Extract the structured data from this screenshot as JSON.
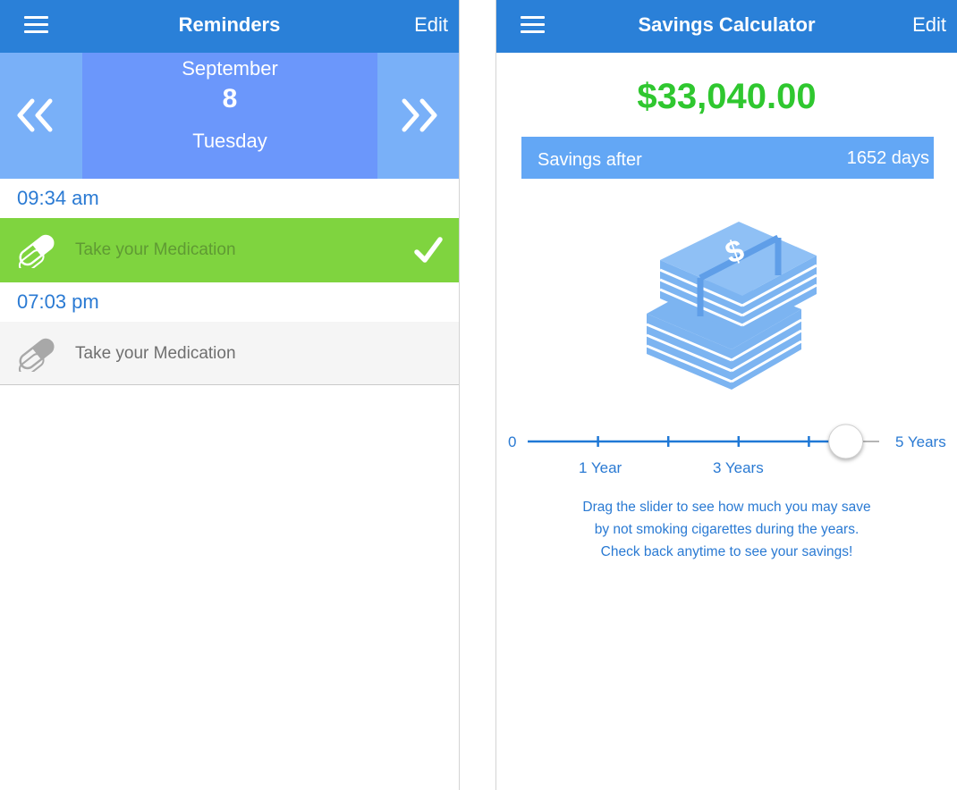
{
  "reminders_screen": {
    "title": "Reminders",
    "edit_label": "Edit",
    "date": {
      "month": "September",
      "day": "8",
      "weekday": "Tuesday"
    },
    "reminders": [
      {
        "time": "09:34 am",
        "text": "Take your Medication",
        "status": "taken",
        "icon": "pill-icon"
      },
      {
        "time": "07:03 pm",
        "text": "Take your Medication",
        "status": "pending",
        "icon": "pill-icon"
      }
    ]
  },
  "savings_screen": {
    "title": "Savings Calculator",
    "edit_label": "Edit",
    "amount": "$33,040.00",
    "savings_label": "Savings after",
    "days": "1652 days",
    "icon": "money-stack-icon",
    "slider": {
      "min_label": "0",
      "max_label": "5 Years",
      "tick_labels": [
        "1 Year",
        "3 Years"
      ],
      "value_fraction": 0.905
    },
    "help_lines": [
      "Drag the slider to see how much you may save",
      "by not smoking cigarettes during the years.",
      "Check back anytime to see your savings!"
    ]
  },
  "colors": {
    "nav_blue": "#2a80d8",
    "date_light": "#79b0f8",
    "date_center": "#6b97fb",
    "done_green": "#7fd43f",
    "amount_green": "#2fc72f",
    "savings_bar": "#63a7f5",
    "text_blue": "#2a7ad3"
  }
}
